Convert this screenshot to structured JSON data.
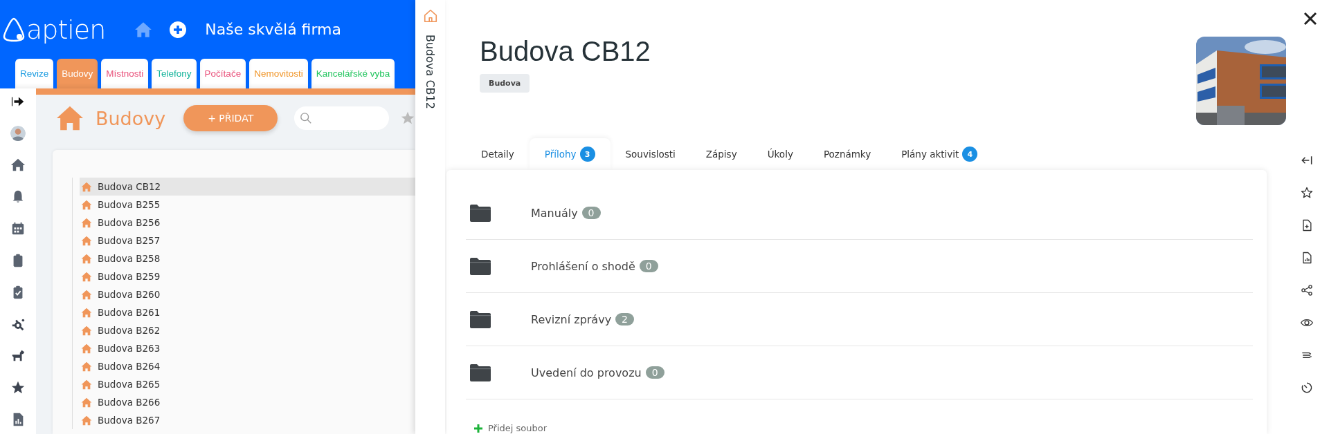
{
  "header": {
    "logo": "aptien",
    "company": "Naše skvělá firma"
  },
  "module_tabs": [
    {
      "label": "Revize",
      "color": "#1a9be0",
      "selected": false
    },
    {
      "label": "Budovy",
      "selected": true
    },
    {
      "label": "Místnosti",
      "color": "#e9507a",
      "selected": false
    },
    {
      "label": "Telefony",
      "color": "#13b39a",
      "selected": false
    },
    {
      "label": "Počítače",
      "color": "#e9507a",
      "selected": false
    },
    {
      "label": "Nemovitosti",
      "color": "#f0962a",
      "selected": false
    },
    {
      "label": "Kancelářské vyba",
      "color": "#22c55e",
      "selected": false
    }
  ],
  "page": {
    "title": "Budovy",
    "add_button": "+ PŘIDAT"
  },
  "buildings": [
    {
      "name": "Budova CB12",
      "selected": true
    },
    {
      "name": "Budova B255",
      "selected": false
    },
    {
      "name": "Budova B256",
      "selected": false
    },
    {
      "name": "Budova B257",
      "selected": false
    },
    {
      "name": "Budova B258",
      "selected": false
    },
    {
      "name": "Budova B259",
      "selected": false
    },
    {
      "name": "Budova B260",
      "selected": false
    },
    {
      "name": "Budova B261",
      "selected": false
    },
    {
      "name": "Budova B262",
      "selected": false
    },
    {
      "name": "Budova B263",
      "selected": false
    },
    {
      "name": "Budova B264",
      "selected": false
    },
    {
      "name": "Budova B265",
      "selected": false
    },
    {
      "name": "Budova B266",
      "selected": false
    },
    {
      "name": "Budova B267",
      "selected": false
    }
  ],
  "detail": {
    "side_title": "Budova CB12",
    "title": "Budova CB12",
    "tag": "Budova",
    "tabs": [
      {
        "label": "Detaily",
        "selected": false
      },
      {
        "label": "Přílohy",
        "count": "3",
        "selected": true
      },
      {
        "label": "Souvislosti",
        "selected": false
      },
      {
        "label": "Zápisy",
        "selected": false
      },
      {
        "label": "Úkoly",
        "selected": false
      },
      {
        "label": "Poznámky",
        "selected": false
      },
      {
        "label": "Plány aktivit",
        "count": "4",
        "selected": false
      }
    ],
    "folders": [
      {
        "name": "Manuály",
        "count": "0"
      },
      {
        "name": "Prohlášení o shodě",
        "count": "0"
      },
      {
        "name": "Revizní zprávy",
        "count": "2"
      },
      {
        "name": "Uvedení do provozu",
        "count": "0"
      }
    ],
    "add_file": "Přidej soubor"
  }
}
